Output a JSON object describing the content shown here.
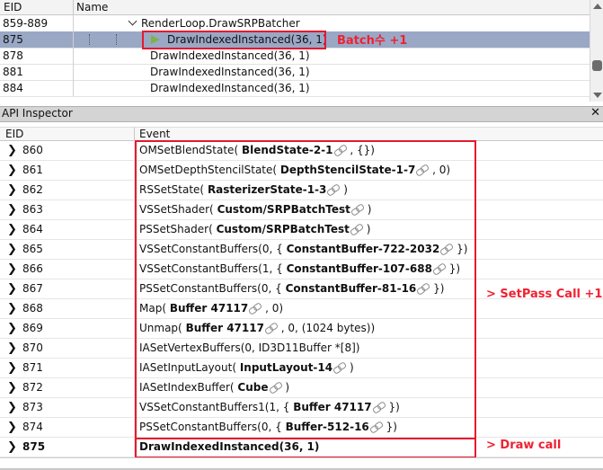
{
  "event_browser": {
    "columns": {
      "eid": "EID",
      "name": "Name"
    },
    "rows": [
      {
        "eid": "859-889",
        "name": "RenderLoop.DrawSRPBatcher"
      },
      {
        "eid": "875",
        "name": "DrawIndexedInstanced(36, 1)"
      },
      {
        "eid": "878",
        "name": "DrawIndexedInstanced(36, 1)"
      },
      {
        "eid": "881",
        "name": "DrawIndexedInstanced(36, 1)"
      },
      {
        "eid": "884",
        "name": "DrawIndexedInstanced(36, 1)"
      }
    ]
  },
  "inspector": {
    "title": "API Inspector",
    "close_glyph": "✕",
    "columns": {
      "eid": "EID",
      "event": "Event"
    },
    "rows": [
      {
        "eid": "860",
        "pre": "OMSetBlendState(",
        "res": "BlendState-2-1",
        "post": ", {})"
      },
      {
        "eid": "861",
        "pre": "OMSetDepthStencilState(",
        "res": "DepthStencilState-1-7",
        "post": ", 0)"
      },
      {
        "eid": "862",
        "pre": "RSSetState(",
        "res": "RasterizerState-1-3",
        "post": ")"
      },
      {
        "eid": "863",
        "pre": "VSSetShader(",
        "res": "Custom/SRPBatchTest",
        "post": ")"
      },
      {
        "eid": "864",
        "pre": "PSSetShader(",
        "res": "Custom/SRPBatchTest",
        "post": ")"
      },
      {
        "eid": "865",
        "pre": "VSSetConstantBuffers(0, {",
        "res": "ConstantBuffer-722-2032",
        "post": "})"
      },
      {
        "eid": "866",
        "pre": "VSSetConstantBuffers(1, {",
        "res": "ConstantBuffer-107-688",
        "post": "})"
      },
      {
        "eid": "867",
        "pre": "PSSetConstantBuffers(0, {",
        "res": "ConstantBuffer-81-16",
        "post": "})"
      },
      {
        "eid": "868",
        "pre": "Map(",
        "res": "Buffer 47117",
        "post": ", 0)"
      },
      {
        "eid": "869",
        "pre": "Unmap(",
        "res": "Buffer 47117",
        "post": ", 0, (1024 bytes))"
      },
      {
        "eid": "870",
        "pre": "IASetVertexBuffers(0, ID3D11Buffer *[8])",
        "res": "",
        "post": ""
      },
      {
        "eid": "871",
        "pre": "IASetInputLayout(",
        "res": "InputLayout-14",
        "post": ")"
      },
      {
        "eid": "872",
        "pre": "IASetIndexBuffer(",
        "res": "Cube",
        "post": ")"
      },
      {
        "eid": "873",
        "pre": "VSSetConstantBuffers1(1, {",
        "res": "Buffer 47117",
        "post": "})"
      },
      {
        "eid": "874",
        "pre": "PSSetConstantBuffers(0, {",
        "res": "Buffer-512-16",
        "post": "})"
      },
      {
        "eid": "875",
        "pre": "DrawIndexedInstanced(36, 1)",
        "res": "",
        "post": ""
      }
    ]
  },
  "annotations": {
    "batch": "Batch수 +1",
    "setpass": "> SetPass Call +1",
    "drawcall": "> Draw call"
  },
  "colors": {
    "annotation": "#e6192e",
    "selection": "#9aa8c6",
    "flag": "#7bb24b"
  }
}
